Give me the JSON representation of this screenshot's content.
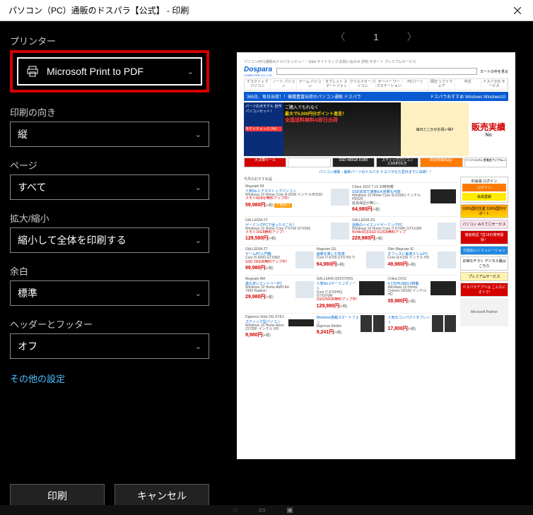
{
  "window": {
    "title": "パソコン（PC）通販のドスパラ【公式】 - 印刷"
  },
  "sidebar": {
    "printer_label": "プリンター",
    "printer_value": "Microsoft Print to PDF",
    "orientation_label": "印刷の向き",
    "orientation_value": "縦",
    "pages_label": "ページ",
    "pages_value": "すべて",
    "scale_label": "拡大/縮小",
    "scale_value": "縮小して全体を印刷する",
    "margins_label": "余白",
    "margins_value": "標準",
    "headerfooter_label": "ヘッダーとフッター",
    "headerfooter_value": "オフ",
    "more_settings": "その他の設定",
    "print_btn": "印刷",
    "cancel_btn": "キャンセル"
  },
  "pager": {
    "current": "1"
  },
  "page": {
    "toplinks": "パソコン(PC)通販のドスパラ    レビュー・Q&A  サイトマップ  お問い合わせ  評判  サポート  プレミアムサービス",
    "logo": "Dospara",
    "logo_sub": "COMPUTER CO.,LTD",
    "search_ph": "カートの中を見る",
    "cats": [
      "デスクトップ\nパソコン",
      "ノート\nパソコン",
      "ゲーム\nパソコン",
      "タブレット\nスマートフォン",
      "クリエイター\nパソコン",
      "サーバー\nワークステーション",
      "PCパーツ",
      "周辺\nソフトウェア",
      "中古",
      "ドスパラの\nサービス"
    ],
    "blue_banner_left": "365日、毎日出荷！！機種豊富出荷のパソコン通販 ドスパラ",
    "blue_banner_right": "ドスパラおすすめ Windows    Windows10",
    "hero": {
      "left_top": "パーツの犬モデル 自作パソコンセット！",
      "left_bottom": "今すぐチェック 241",
      "mid1": "ご購入でもれなく",
      "mid2": "最大で5,000円分ポイント進呈！",
      "mid3": "全国送料無料&即日出荷",
      "right_label": "毎日どこかがお買い得!!",
      "right_big": "No",
      "sale": "販売実績",
      "side": "インテルCPU 提携度アジアNo.1"
    },
    "strip": {
      "sale": "大決算セール",
      "ssd": "SSD 480GB 8,880",
      "stick": "スティックパソコン 2,500円引き",
      "last": "限定特価商品!!"
    },
    "linkline": "パソコン通販・最新パーツのドスパラ ドスパラなら翌日までに出荷！！",
    "sec_title": "今月のおすすめ品",
    "login_title": "ID会員 ログイン",
    "login_btn": "ログイン",
    "member_btn": "会員登録",
    "rail": {
      "dom": "100%国内生産 100%国内サポート",
      "mitate": "パソコン みたて◎サービス",
      "ship": "徹底検証 7営18日発売開始！",
      "pay": "分割払いシミュレーション",
      "flyer": "お得なチラシ デジタル版はこちら",
      "premium": "プレミアムサービス",
      "app": "ドスパラアプリは こんなにオトク!",
      "ms": "Microsoft Partner"
    },
    "rows": [
      {
        "hl": "Magnate IM",
        "hr": "Critea 2016 7.15 20時到着",
        "l": {
          "nm": "人気No.1 デスクトップパソコン",
          "sp": "Windows 10 Home\nCore i5-6500\nインテルHD530",
          "note": "メモリ8GBが無料アップ中！",
          "pr": "59,980円",
          "tax": "(+税)",
          "badge": "人気No.1"
        },
        "r": {
          "nm": "SSD追加で速度&大容量も可能",
          "sp": "Windows 10 Home\nCore i3-6100U\nインテルHD520",
          "note": "延長保証が無い…",
          "pr": "64,980円",
          "tax": "(+税)"
        }
      },
      {
        "hl": "GALLERIA XT",
        "hr": "GALLERIA ZG",
        "l": {
          "nm": "ゲーミングPCで迷ったらこれ！",
          "sp": "Windows 10 Home\nCore i7-6700\nGTX960",
          "note": "メモリ16GB無料アップ！",
          "pr": "129,580円",
          "tax": "(+税)"
        },
        "r": {
          "nm": "話題のハイエンドゲーミングPC",
          "sp": "Windows 10 Home\nCore i7-6700K\nGTX1080",
          "note": "NVMe対応SSD 512GB無料アップ",
          "pr": "229,980円",
          "tax": "(+税)"
        }
      },
      {
        "hl": "GALLERIA ZT",
        "hm": "Magnate GE",
        "hr": "Slim Magnate IE",
        "l": {
          "nm": "ゲームPC入門機",
          "sp": "Core i5-6500\nGTX960",
          "note": "SSD 250GB無料アップ中！",
          "pr": "99,980円",
          "tax": "(+税)"
        },
        "m": {
          "nm": "画像を楽しむ快適",
          "sp": "Core i7-6700\nGTX750 Ti",
          "pr": "94,980円",
          "tax": "(+税)"
        },
        "r": {
          "nm": "オフィスに最適スリムPC",
          "sp": "Core i3-6100\nインテル HD",
          "pr": "49,980円",
          "tax": "(+税)"
        }
      },
      {
        "hl": "Magnate AM",
        "hm": "GALLERIA QSF570HG",
        "hr": "Critea DX11",
        "l": {
          "nm": "最も安いエントリーPC",
          "sp": "Windows 10 Home\nAMD A4-7300\nRadeon",
          "pr": "29,980円",
          "tax": "(+税)"
        },
        "m": {
          "nm": "人気No.1ゲーミングノート",
          "sp": "Core i7-6700HQ\nGTX970M",
          "note": "SSD250GB無料アップ中！",
          "pr": "129,980円",
          "tax": "(+税)"
        },
        "r": {
          "nm": "4.1万円USB3.0搭載",
          "sp": "Windows 10 Home\nCeleron N3150\nインテル HD",
          "pr": "39,980円",
          "tax": "(+税)"
        }
      },
      {
        "hl": "Diginnos Stick DG-STK3",
        "hm": "",
        "hr": "",
        "l": {
          "nm": "スティック型パソコン",
          "sp": "Windows 10 Home\nAtom Z3735F\nインテル HD",
          "pr": "9,980円",
          "tax": "(+税)"
        },
        "m": {
          "nm": "Windows搭載スマートフォン",
          "sp": "Diginnos Mobile",
          "pr": "9,241円",
          "tax": "(+税)"
        },
        "r": {
          "nm": "人気のコンパクトタブレット",
          "sp": "",
          "pr": "17,800円",
          "tax": "(+税)"
        }
      }
    ]
  }
}
